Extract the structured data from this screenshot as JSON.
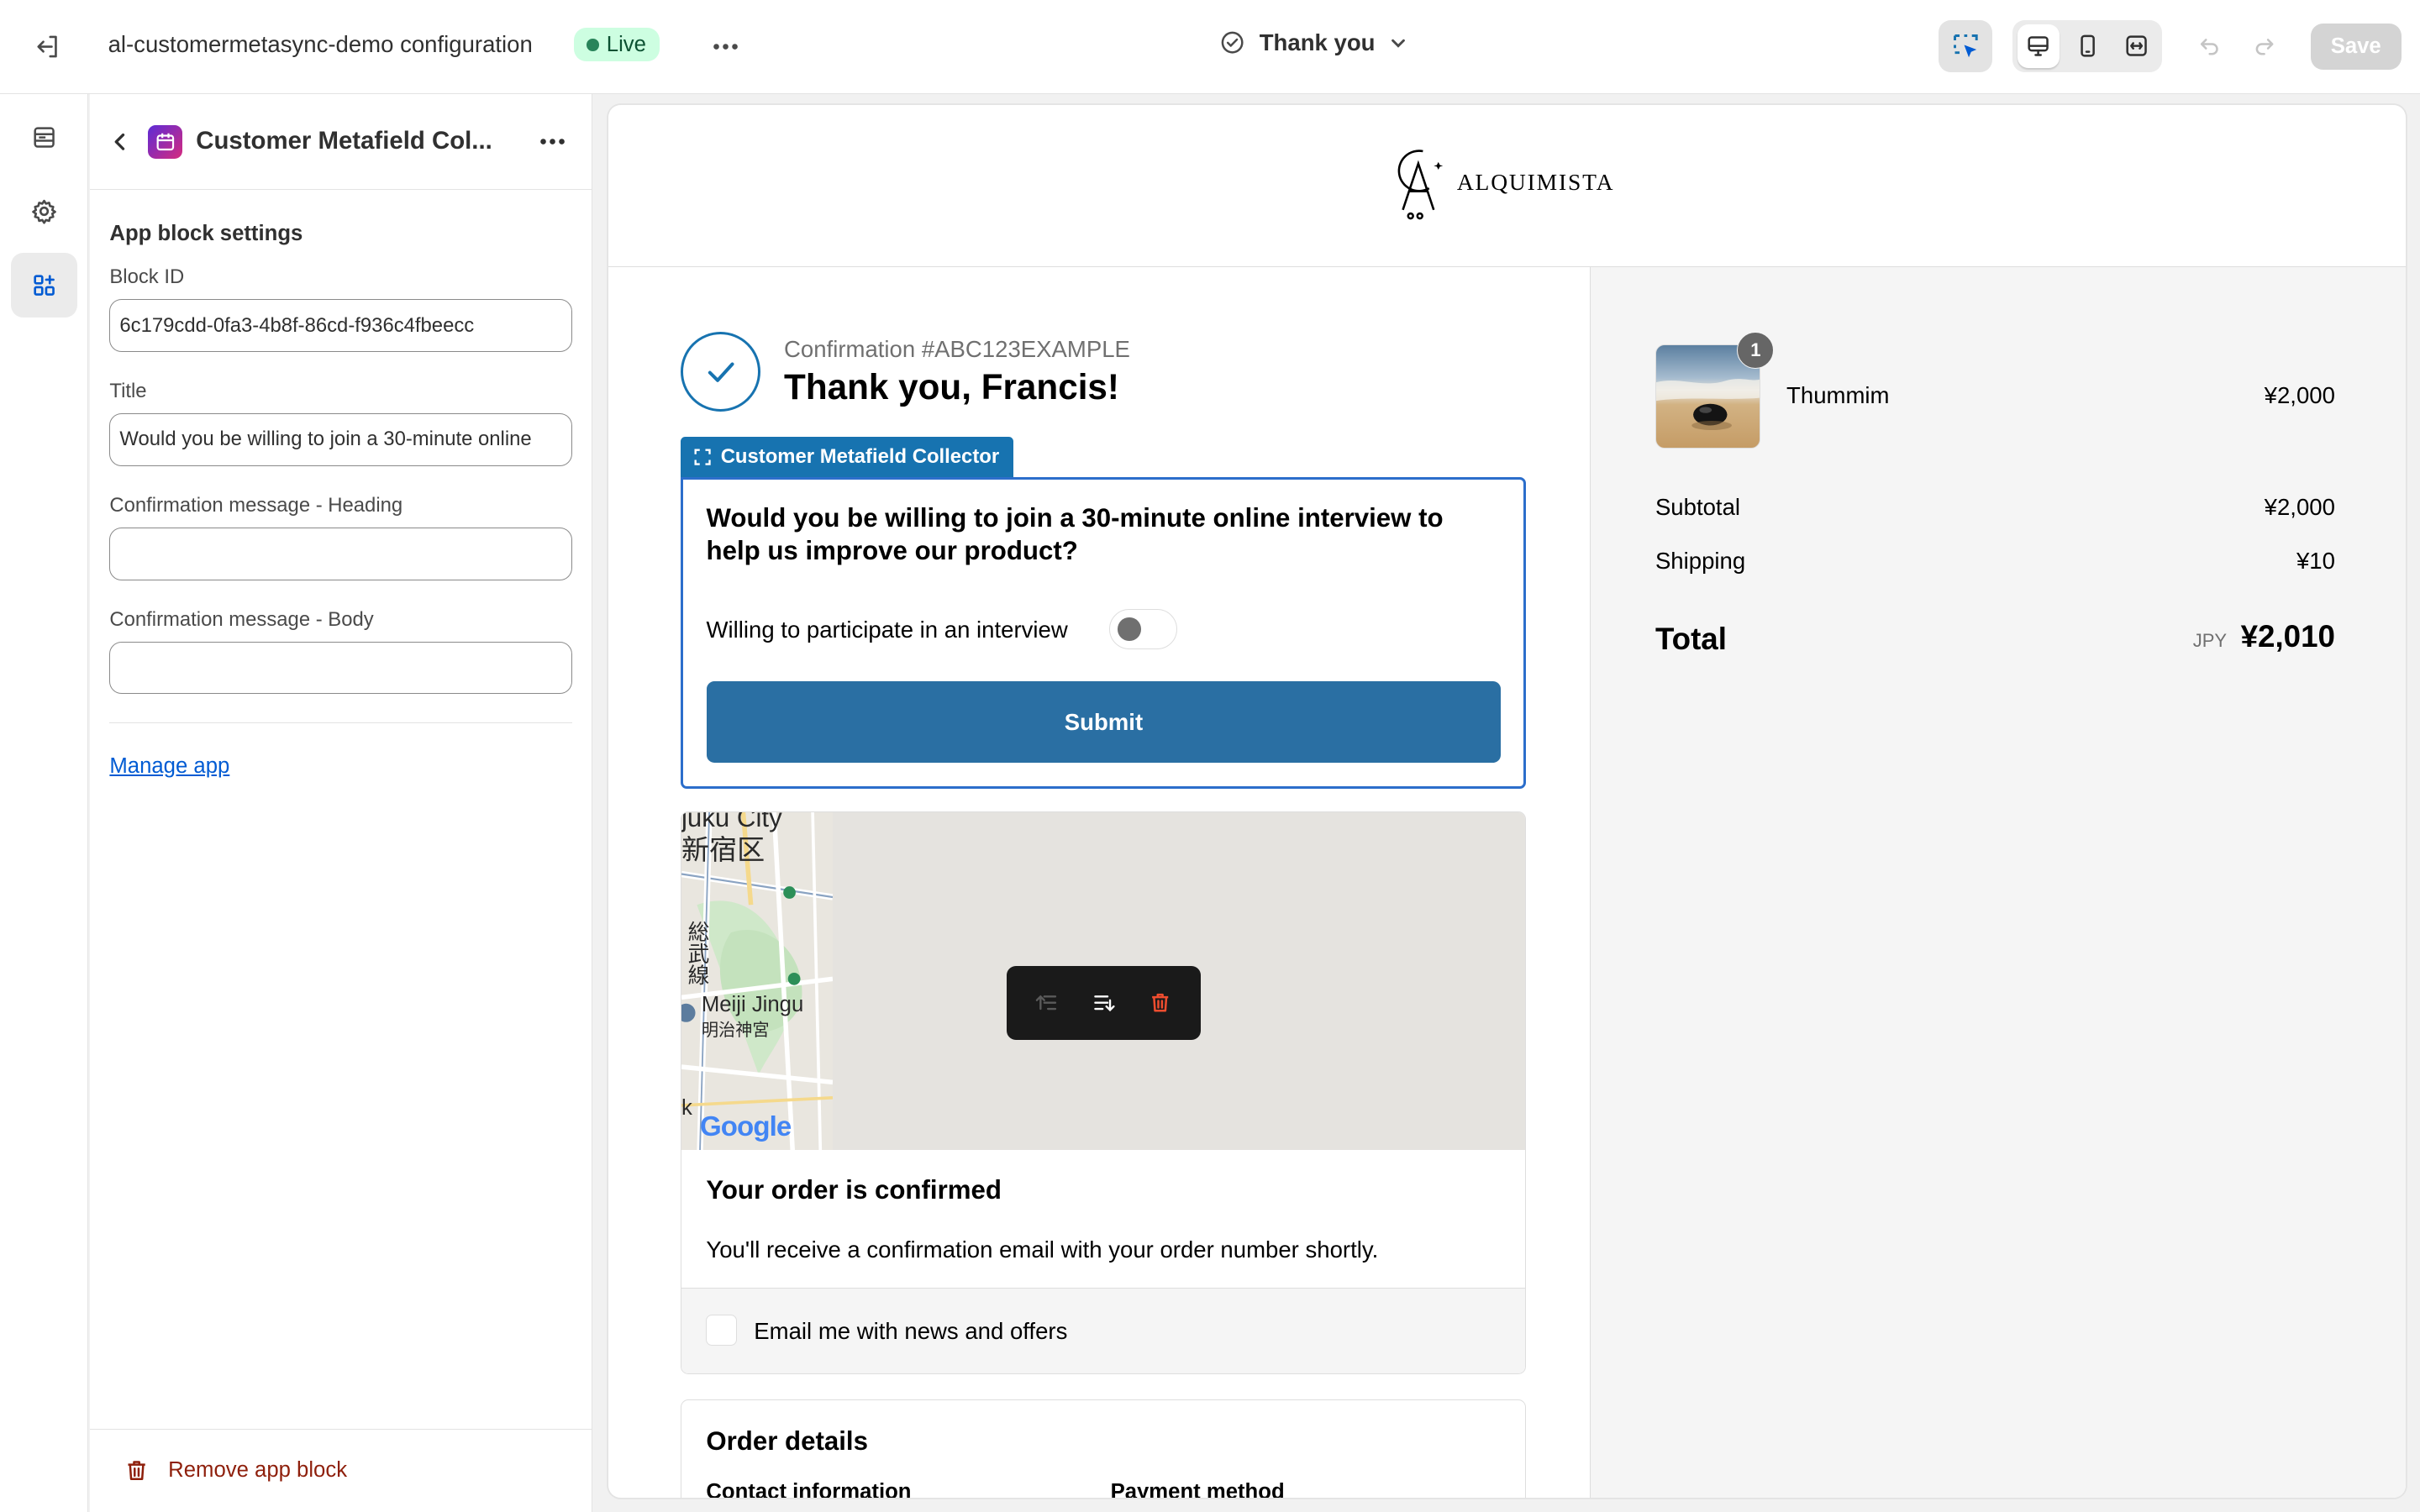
{
  "topbar": {
    "config_title": "al-customermetasync-demo configuration",
    "live_badge": "Live",
    "template": "Thank you",
    "save_label": "Save"
  },
  "panel": {
    "header_title": "Customer Metafield Col...",
    "section_title": "App block settings",
    "fields": [
      {
        "label": "Block ID",
        "value": "6c179cdd-0fa3-4b8f-86cd-f936c4fbeecc"
      },
      {
        "label": "Title",
        "value": "Would you be willing to join a 30-minute online"
      },
      {
        "label": "Confirmation message - Heading",
        "value": ""
      },
      {
        "label": "Confirmation message - Body",
        "value": ""
      }
    ],
    "manage_link": "Manage app",
    "remove_label": "Remove app block"
  },
  "preview": {
    "brand": "ALQUIMISTA",
    "confirmation_number": "Confirmation #ABC123EXAMPLE",
    "thanks": "Thank you, Francis!",
    "block_tag": "Customer Metafield Collector",
    "question": "Would you be willing to join a 30-minute online interview to help us improve our product?",
    "toggle_label": "Willing to participate in an interview",
    "toggle_on": false,
    "submit_label": "Submit",
    "map": {
      "label_top": "juku City",
      "label_jp": "新宿区",
      "label_line": "総武線",
      "label_place": "Meiji Jingu",
      "label_place_jp": "明治神宮",
      "label_k": "k",
      "attribution": "Google"
    },
    "order_confirmed_heading": "Your order is confirmed",
    "order_confirmed_body": "You'll receive a confirmation email with your order number shortly.",
    "newsletter_label": "Email me with news and offers",
    "order_details_heading": "Order details",
    "contact_information": "Contact information",
    "payment_method": "Payment method"
  },
  "summary": {
    "item": {
      "quantity": "1",
      "name": "Thummim",
      "price": "¥2,000"
    },
    "subtotal_label": "Subtotal",
    "subtotal_value": "¥2,000",
    "shipping_label": "Shipping",
    "shipping_value": "¥10",
    "total_label": "Total",
    "currency": "JPY",
    "total_value": "¥2,010"
  },
  "colors": {
    "accent": "#1773b0",
    "submit": "#2a6fa3",
    "selection": "#2c6ecb",
    "live_bg": "#cdfee1",
    "danger": "#8e1f0b",
    "link": "#005bd3"
  }
}
